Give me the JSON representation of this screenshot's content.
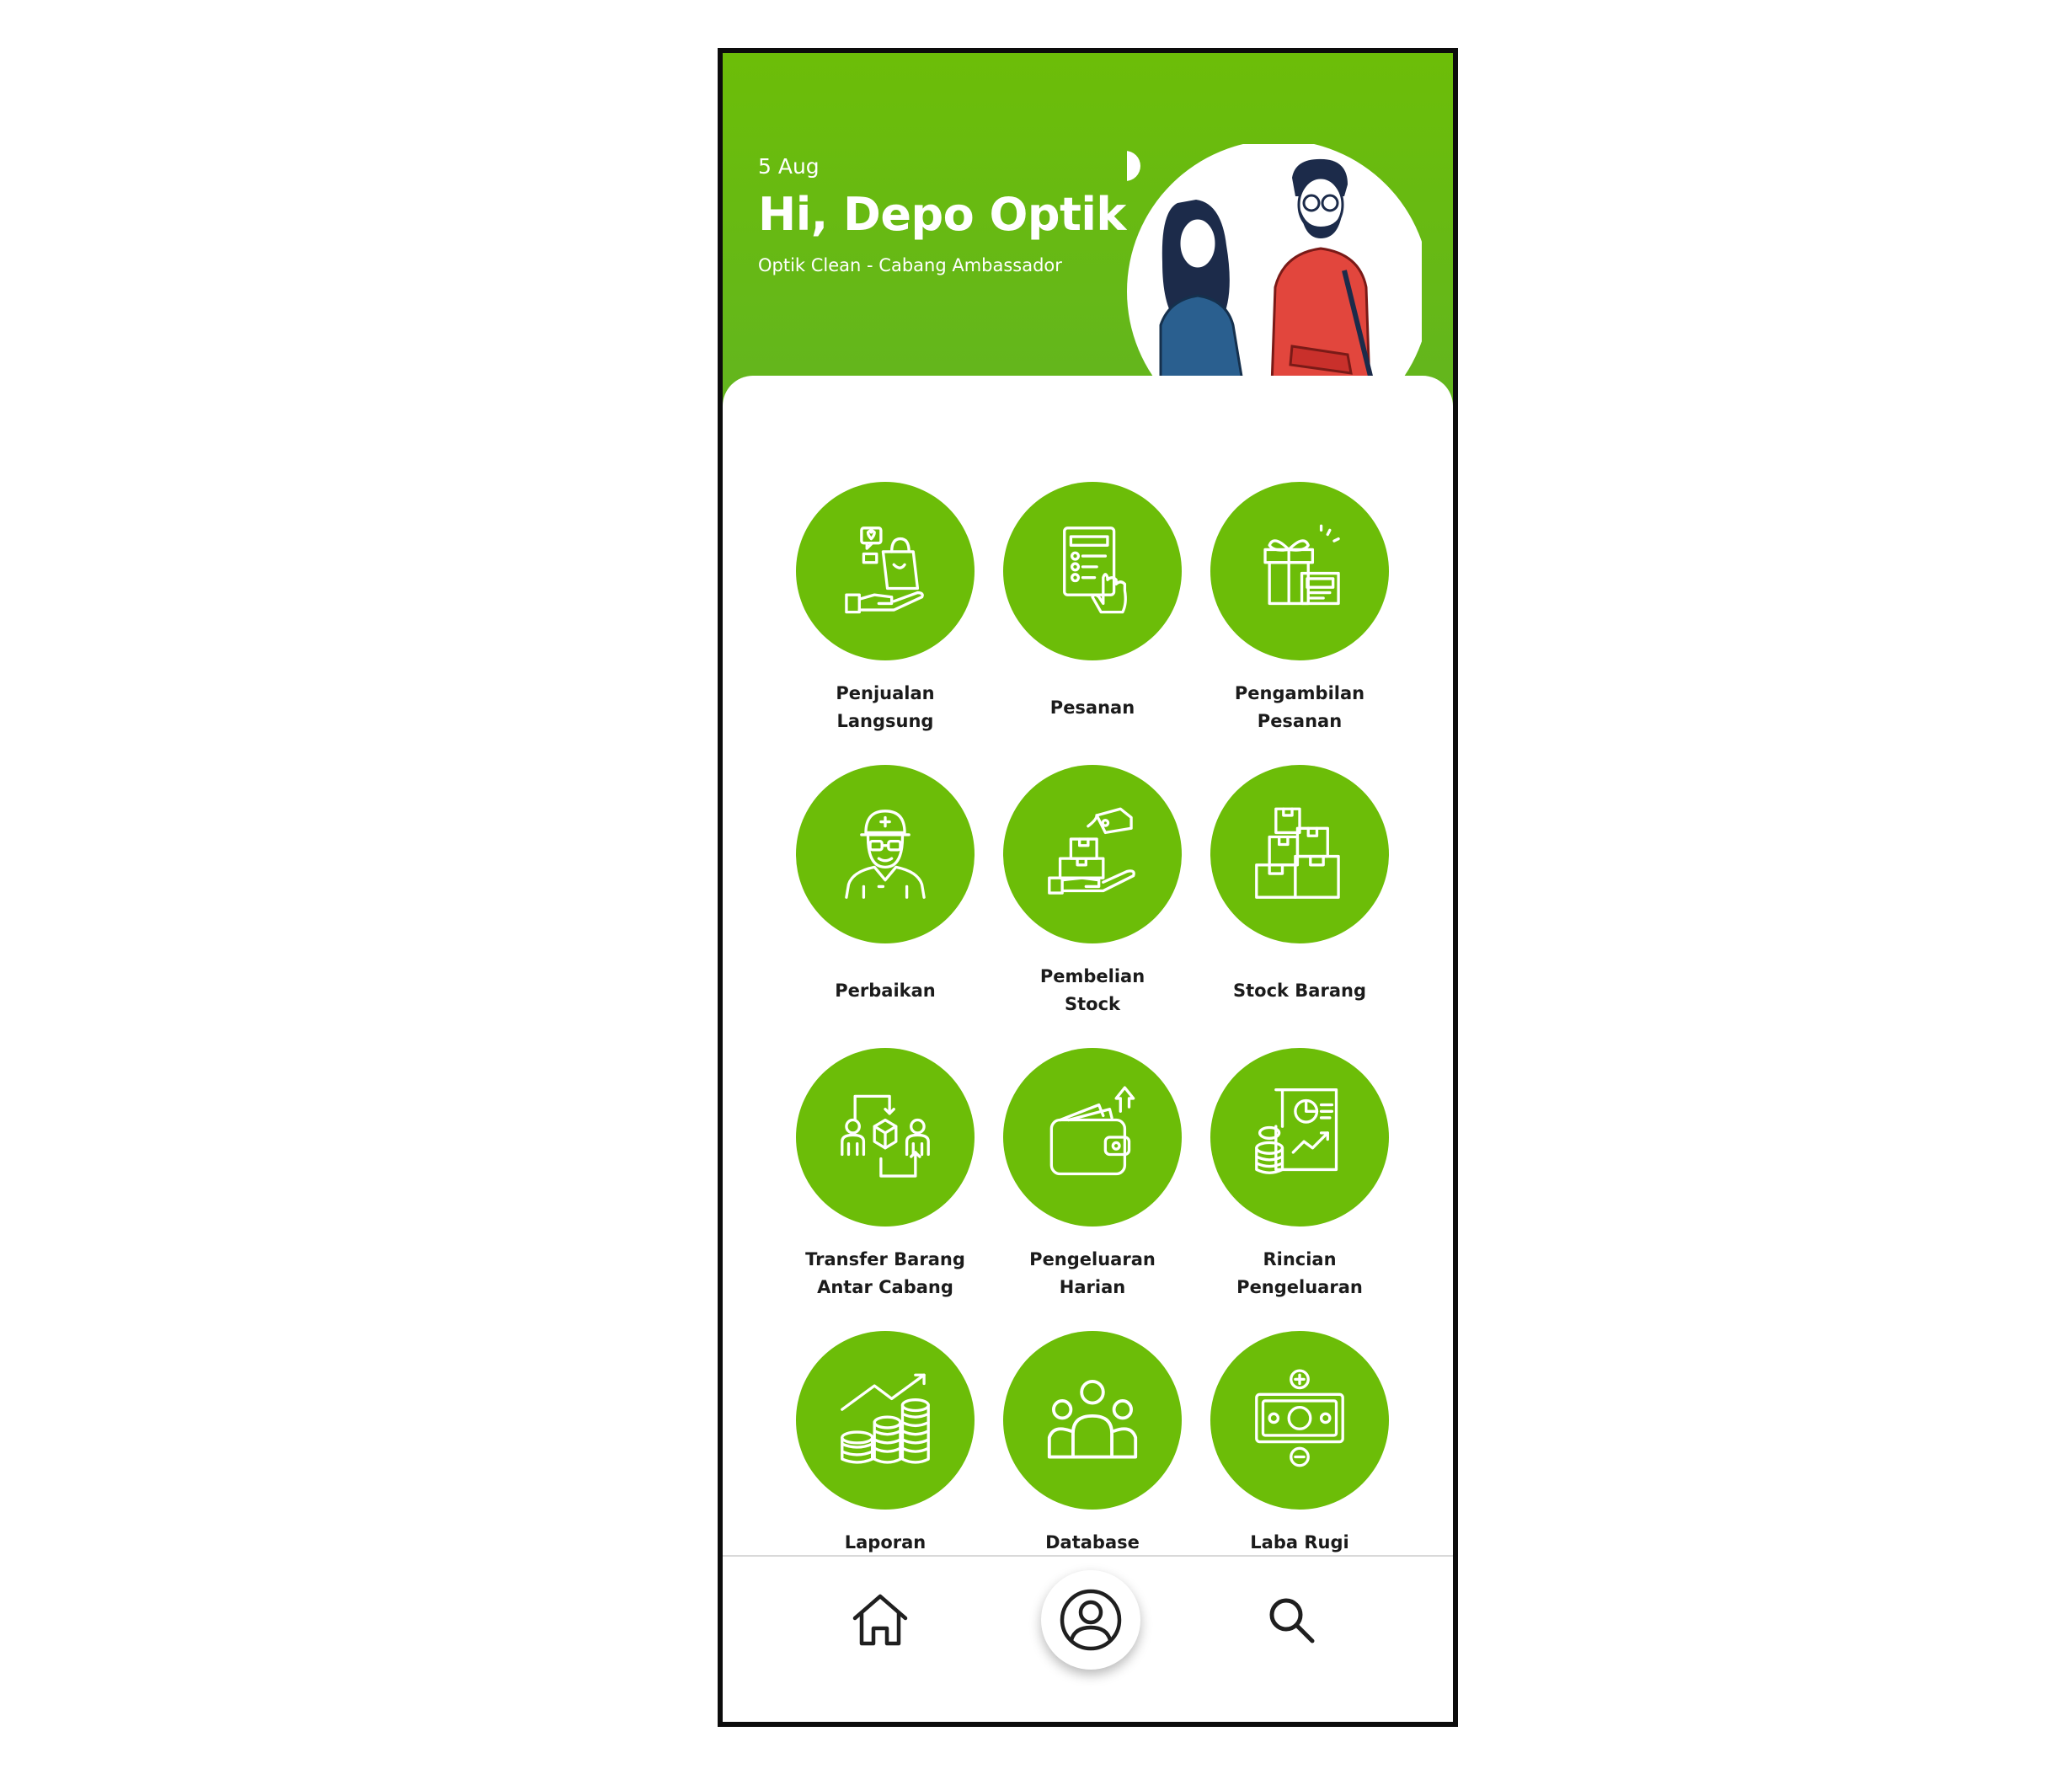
{
  "header": {
    "date": "5 Aug",
    "greeting": "Hi, Depo Optik",
    "branch": "Optik Clean - Cabang Ambassador",
    "illustration": "couple-illustration"
  },
  "menu": {
    "items": [
      {
        "label": "Penjualan\nLangsung",
        "icon": "hand-shopping-bag-icon"
      },
      {
        "label": "Pesanan",
        "icon": "order-list-icon"
      },
      {
        "label": "Pengambilan\nPesanan",
        "icon": "gift-box-icon"
      },
      {
        "label": "Perbaikan",
        "icon": "technician-icon"
      },
      {
        "label": "Pembelian\nStock",
        "icon": "hand-box-tag-icon"
      },
      {
        "label": "Stock Barang",
        "icon": "stacked-boxes-icon"
      },
      {
        "label": "Transfer Barang\nAntar Cabang",
        "icon": "transfer-icon"
      },
      {
        "label": "Pengeluaran\nHarian",
        "icon": "wallet-icon"
      },
      {
        "label": "Rincian\nPengeluaran",
        "icon": "report-coins-icon"
      },
      {
        "label": "Laporan\nPenjualan",
        "icon": "sales-growth-icon"
      },
      {
        "label": "Database\nPelanggan",
        "icon": "customers-icon"
      },
      {
        "label": "Laba Rugi\nToko",
        "icon": "money-plus-minus-icon"
      }
    ]
  },
  "nav": {
    "home": "home-icon",
    "profile": "profile-icon",
    "search": "search-icon"
  },
  "colors": {
    "primary": "#6cbd08",
    "text": "#1b1b1b"
  }
}
